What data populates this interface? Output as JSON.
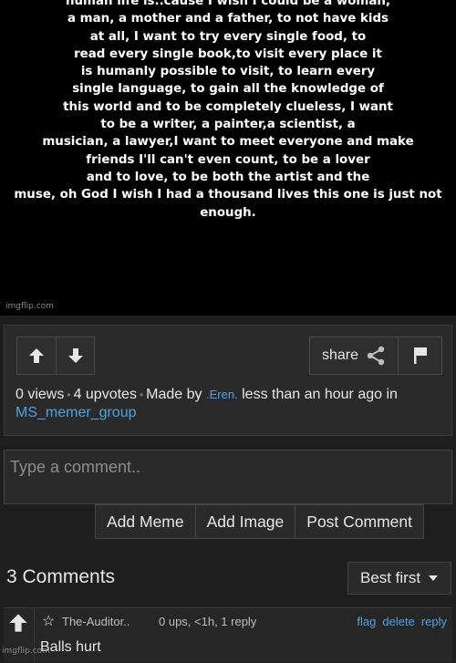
{
  "meme": {
    "text": "human life is..cause I wish I could be a woman,\na man, a mother and a father, to not have kids\nat all, I want to try every single food, to\nread every single book,to visit every place it\nis humanly possible to visit, to learn every\nsingle language, to gain all the knowledge of\nthis world and to be completely clueless, I want\nto be a writer, a painter,a scientist, a\nmusician, a lawyer,I want to meet everyone and make\nfriends I'll can't even count, to be a lover\nand to love, to be both the artist and the\nmuse, oh God I wish I had a thousand lives this one is just not enough.",
    "watermark": "imgflip.com"
  },
  "actions": {
    "share_label": "share",
    "upvote_icon": "arrow-up-icon",
    "downvote_icon": "arrow-down-icon",
    "flag_icon": "flag-icon"
  },
  "stats": {
    "views": "0 views",
    "upvotes": "4 upvotes",
    "made_by_prefix": "Made by",
    "maker": ".Eren.",
    "time_text": "less than an hour ago in",
    "stream": "MS_memer_group"
  },
  "comment_form": {
    "placeholder": "Type a comment..",
    "add_meme": "Add Meme",
    "add_image": "Add Image",
    "post_comment": "Post Comment"
  },
  "comments": {
    "count_title": "3 Comments",
    "sort_label": "Best first",
    "items": [
      {
        "badge": "☆",
        "user": "The-Auditor..",
        "meta": "0 ups, <1h, 1 reply",
        "flag": "flag",
        "delete": "delete",
        "reply": "reply",
        "text": "Balls hurt"
      }
    ]
  },
  "footer_watermark": "imgflip.com",
  "colors": {
    "background": "#1e1e1e",
    "panel": "#2a2a2a",
    "link": "#4fa3e6"
  }
}
